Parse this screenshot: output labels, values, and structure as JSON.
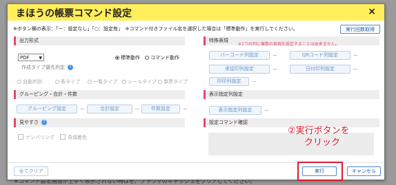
{
  "dialog": {
    "title": "まほうの帳票コマンド設定",
    "close_label": "×",
    "notice": "※ボタン横の表示：「ー：設定なし」「○：設定有」　※コマンド付きファイル名を選択した場合は「標準動作」を実行してください。",
    "history_button": "実行回数取得"
  },
  "output_format": {
    "section_label": "出力形式",
    "format_value": "PDF",
    "format_options": [
      "PDF"
    ],
    "radio_standard": "標準動作",
    "radio_command": "コマンド動作",
    "selected": "標準動作"
  },
  "type_priority": {
    "section_label": "作成タイプ優先判定",
    "options": [
      "自動判別",
      "表タイプ",
      "一覧タイプ",
      "シールタイプ",
      "単票タイプ"
    ]
  },
  "grouping": {
    "section_label": "グルーピング・合計・件数",
    "buttons": [
      {
        "label": "グルーピング設定",
        "status": "ー"
      },
      {
        "label": "合計設定",
        "status": "ー"
      },
      {
        "label": "件数設定",
        "status": "ー"
      }
    ]
  },
  "readability": {
    "section_label": "見やすさ",
    "checkboxes": [
      "ナンバリング",
      "奇偶着色"
    ]
  },
  "special": {
    "section_label": "特殊表現",
    "warning": "※1つの列に複数の表現を設定することは出来ません。",
    "buttons": [
      {
        "label": "バーコード列設定",
        "status": "ー"
      },
      {
        "label": "QRコード列設定",
        "status": "ー"
      },
      {
        "label": "承認印列設定",
        "status": "ー"
      },
      {
        "label": "日付印列設定",
        "status": "ー"
      },
      {
        "label": "印印列設定",
        "status": "ー"
      }
    ]
  },
  "display_column": {
    "section_label": "表示指定列設定",
    "button": {
      "label": "表示指定列設定",
      "status": "ー"
    }
  },
  "confirm": {
    "section_label": "設定コマンド確認",
    "value": ""
  },
  "footer": {
    "clear_label": "全てクリア",
    "execute_label": "実行",
    "cancel_label": "キャンセル"
  },
  "annotation": {
    "line1": "②実行ボタンを",
    "line2": "クリック"
  },
  "background": {
    "text": "※コマンド設定画面が上手く表示されない時はを、ブラウザのキャッシュをクリアしてください。"
  },
  "colors": {
    "title_bar": "#ffef5a",
    "section_accent": "#e8456a",
    "primary_button": "#1d5aa8",
    "disabled_button": "#6b93c4",
    "annotation": "#e0182c"
  }
}
